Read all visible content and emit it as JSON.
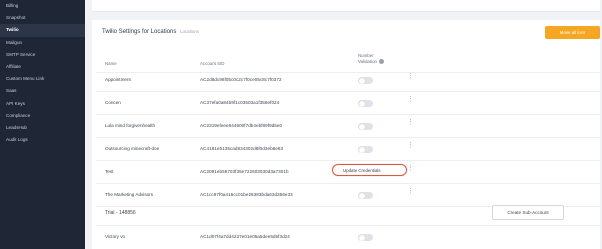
{
  "sidebar": {
    "items": [
      {
        "label": "Billing",
        "active": false
      },
      {
        "label": "Snapshot",
        "active": false
      },
      {
        "label": "Twilio",
        "active": true
      },
      {
        "label": "Mailgun",
        "active": false
      },
      {
        "label": "SMTP Service",
        "active": false
      },
      {
        "label": "Affiliate",
        "active": false
      },
      {
        "label": "Custom Menu Link",
        "active": false
      },
      {
        "label": "Saas",
        "active": false
      },
      {
        "label": "API Keys",
        "active": false
      },
      {
        "label": "Compliance",
        "active": false
      },
      {
        "label": "LeadsHub",
        "active": false
      },
      {
        "label": "Audit Logs",
        "active": false
      }
    ]
  },
  "card": {
    "title": "Twilio Settings for Locations",
    "subtitle": "Locations",
    "primary_button": "Move all locs",
    "columns": {
      "name": "Name",
      "account_sid": "Account SID",
      "number_validation": "Number Validation"
    }
  },
  "rows": [
    {
      "name": "Appointment",
      "sid": "AC2d8dc96f05c0c2c7f0ce05c8c7f0372"
    },
    {
      "name": "Concen",
      "sid": "AC37efa0a84b9f1c03503a1f358ef024"
    },
    {
      "name": "Lula mind forgivenhealth",
      "sid": "AC2319efeee644600f7db4ebf89f9d5e0"
    },
    {
      "name": "Outsourcing minecraft-doe",
      "sid": "AC4181e5135cad834302d8f0d3eb8e83"
    },
    {
      "name": "Test",
      "sid": "AC2091eb56703f35e722503030d3a7301b"
    },
    {
      "name": "The Marketing Advisors",
      "sid": "AC1cc97f0a415cc01be26383bda63d356e33"
    }
  ],
  "popup_menu": {
    "item": "Update Credentials"
  },
  "trial": {
    "label": "Trial - 148856",
    "button": "Create Sub-Account"
  },
  "last_row": {
    "name": "Victory vo",
    "sid": "AC1d07f4a7dd4237e01e05a5dee5d5f3d24"
  },
  "colors": {
    "sidebar_bg": "#1f2635",
    "accent": "#f5a623",
    "highlight": "#e2563a"
  }
}
